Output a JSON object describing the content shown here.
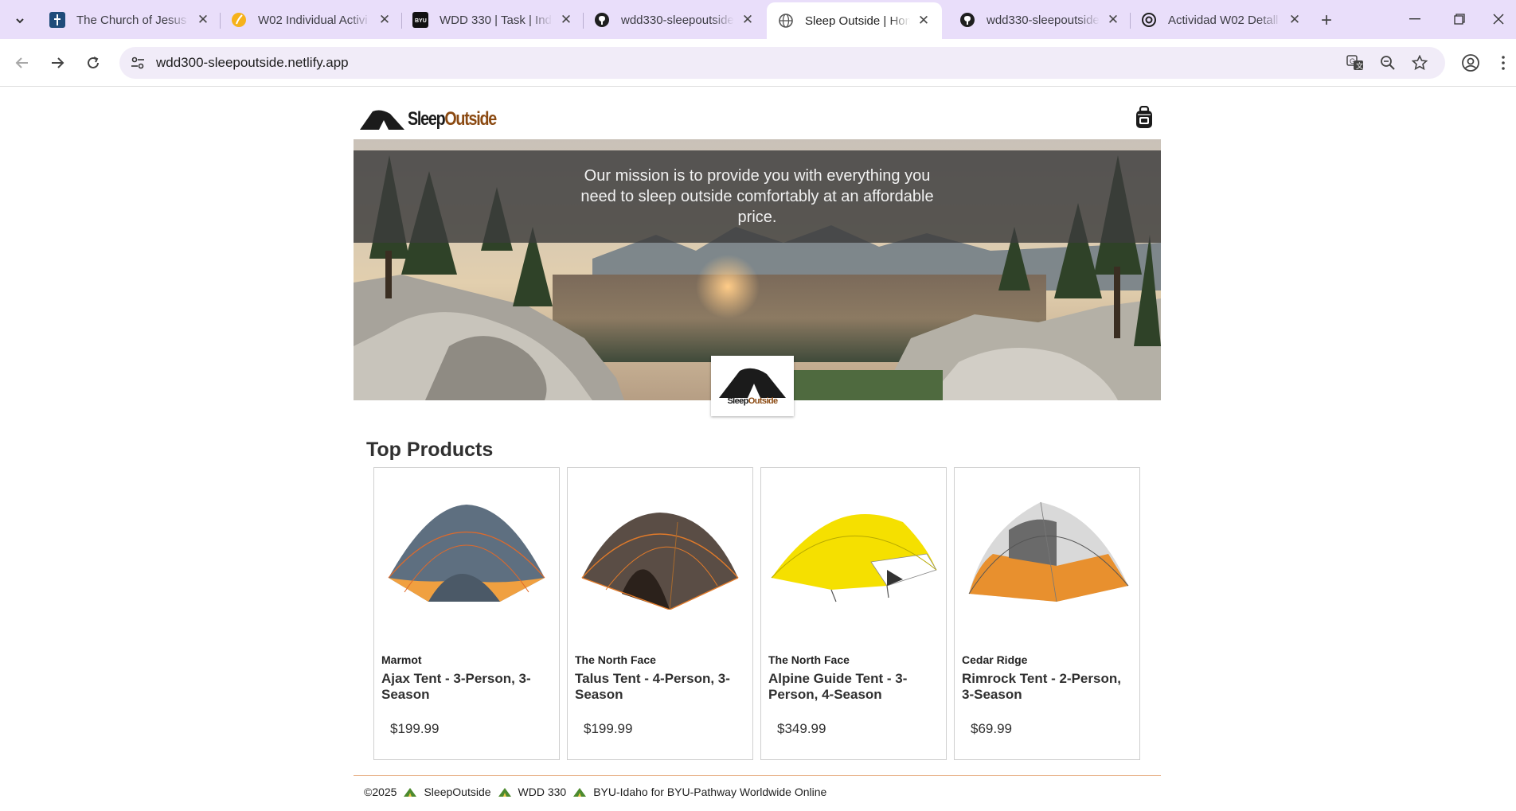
{
  "browser": {
    "tabs": [
      {
        "title": "The Church of Jesus C",
        "favicon": "church-favicon",
        "active": false
      },
      {
        "title": "W02 Individual Activi",
        "favicon": "byu-pathway-favicon",
        "active": false
      },
      {
        "title": "WDD 330 | Task | Indi",
        "favicon": "byu-favicon",
        "active": false
      },
      {
        "title": "wdd330-sleepoutside",
        "favicon": "github-favicon",
        "active": false
      },
      {
        "title": "Sleep Outside | Home",
        "favicon": "globe-favicon",
        "active": true
      },
      {
        "title": "wdd330-sleepoutside",
        "favicon": "github-favicon",
        "active": false
      },
      {
        "title": "Actividad W02 Detall",
        "favicon": "chatgpt-favicon",
        "active": false
      }
    ],
    "url": "wdd300-sleepoutside.netlify.app",
    "accent": "#e9defa"
  },
  "site": {
    "logo": {
      "part1": "Sleep",
      "part2": "Outside"
    },
    "hero": {
      "mission": "Our mission is to provide you with everything you need to sleep outside comfortably at an affordable price.",
      "badge": {
        "part1": "Sleep",
        "part2": "Outside"
      }
    },
    "section_title": "Top Products",
    "products": [
      {
        "brand": "Marmot",
        "name": "Ajax Tent - 3-Person, 3-Season",
        "price": "$199.99",
        "color": "#f0a040",
        "fly": "#5e6f80"
      },
      {
        "brand": "The North Face",
        "name": "Talus Tent - 4-Person, 3-Season",
        "price": "$199.99",
        "color": "#a86a2e",
        "fly": "#5a4d45"
      },
      {
        "brand": "The North Face",
        "name": "Alpine Guide Tent - 3-Person, 4-Season",
        "price": "$349.99",
        "color": "#f5e000",
        "fly": "#e8d800"
      },
      {
        "brand": "Cedar Ridge",
        "name": "Rimrock Tent - 2-Person, 3-Season",
        "price": "$69.99",
        "color": "#e8902e",
        "fly": "#d9d9d9"
      }
    ],
    "footer": {
      "copyright": "©2025",
      "items": [
        "SleepOutside",
        "WDD 330",
        "BYU-Idaho for BYU-Pathway Worldwide Online"
      ]
    }
  }
}
